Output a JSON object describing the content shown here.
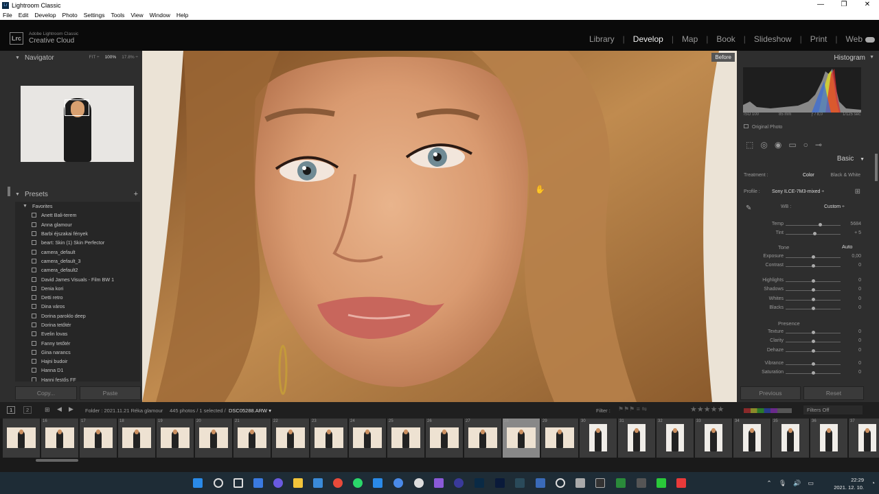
{
  "window": {
    "title": "Lightroom Classic",
    "menu": [
      "File",
      "Edit",
      "Develop",
      "Photo",
      "Settings",
      "Tools",
      "View",
      "Window",
      "Help"
    ],
    "controls": [
      "—",
      "❐",
      "✕"
    ]
  },
  "header": {
    "logo_mark": "Lrc",
    "brand_small": "Adobe Lightroom Classic",
    "brand_big": "Creative Cloud",
    "modules": [
      "Library",
      "Develop",
      "Map",
      "Book",
      "Slideshow",
      "Print",
      "Web"
    ],
    "active_module": "Develop"
  },
  "navigator": {
    "title": "Navigator",
    "options": [
      "FIT ÷",
      "100%",
      "17.8% ÷"
    ],
    "selected_option": "100%"
  },
  "presets": {
    "title": "Presets",
    "add_icon": "+",
    "folder": "Favorites",
    "items": [
      "Anett Bali-terem",
      "Anna glamour",
      "Barbi éjszakai fények",
      "beart: Skin (1) Skin Perfector",
      "camera_default",
      "camera_default_3",
      "camera_default2",
      "David James Visuals - Film BW 1",
      "Denia kori",
      "Detti retro",
      "Dina város",
      "Dorina paroklo deep",
      "Dorina tetőtér",
      "Evelin lovas",
      "Fanny tetőtér",
      "Gina narancs",
      "Hajni budoir",
      "Hanna D1",
      "Hanni festős FF"
    ]
  },
  "left_buttons": {
    "copy": "Copy...",
    "paste": "Paste"
  },
  "image": {
    "before_label": "Before"
  },
  "histogram": {
    "title": "Histogram",
    "iso": "ISO 100",
    "focal": "85 mm",
    "aperture": "ƒ / 8,0",
    "shutter": "1/125 sec",
    "original_photo": "Original Photo"
  },
  "basic": {
    "title": "Basic",
    "treatment_label": "Treatment :",
    "treatment_color": "Color",
    "treatment_bw": "Black & White",
    "profile_label": "Profile :",
    "profile_value": "Sony ILCE-7M3-mixed ÷",
    "wb_label": "WB :",
    "wb_value": "Custom ÷",
    "tone_label": "Tone",
    "auto_label": "Auto",
    "presence_label": "Presence",
    "sliders": [
      {
        "name": "Temp",
        "value": "5684",
        "pos": 0.62
      },
      {
        "name": "Tint",
        "value": "+ 5",
        "pos": 0.52
      },
      {
        "name": "Exposure",
        "value": "0,00",
        "pos": 0.5
      },
      {
        "name": "Contrast",
        "value": "0",
        "pos": 0.5
      },
      {
        "name": "Highlights",
        "value": "0",
        "pos": 0.5
      },
      {
        "name": "Shadows",
        "value": "0",
        "pos": 0.5
      },
      {
        "name": "Whites",
        "value": "0",
        "pos": 0.5
      },
      {
        "name": "Blacks",
        "value": "0",
        "pos": 0.5
      },
      {
        "name": "Texture",
        "value": "0",
        "pos": 0.5
      },
      {
        "name": "Clarity",
        "value": "0",
        "pos": 0.5
      },
      {
        "name": "Dehaze",
        "value": "0",
        "pos": 0.5
      },
      {
        "name": "Vibrance",
        "value": "0",
        "pos": 0.5
      },
      {
        "name": "Saturation",
        "value": "0",
        "pos": 0.5
      }
    ]
  },
  "right_buttons": {
    "previous": "Previous",
    "reset": "Reset"
  },
  "filmbar": {
    "view1": "1",
    "view2": "2",
    "folder_text": "Folder : 2021.11.21 Réka glamour",
    "count_text": "445 photos / 1 selected /",
    "filename": "DSC05288.ARW ▾",
    "filter_label": "Filter :",
    "filters_off": "Filters Off"
  },
  "filmstrip": {
    "numbers": [
      "",
      "16",
      "17",
      "18",
      "19",
      "20",
      "21",
      "22",
      "23",
      "24",
      "25",
      "26",
      "27",
      "28",
      "29",
      "30",
      "31",
      "32",
      "33",
      "34",
      "35",
      "36",
      "37"
    ],
    "selected_index": 13
  },
  "taskbar": {
    "time": "22:29",
    "date": "2021. 12. 10."
  }
}
